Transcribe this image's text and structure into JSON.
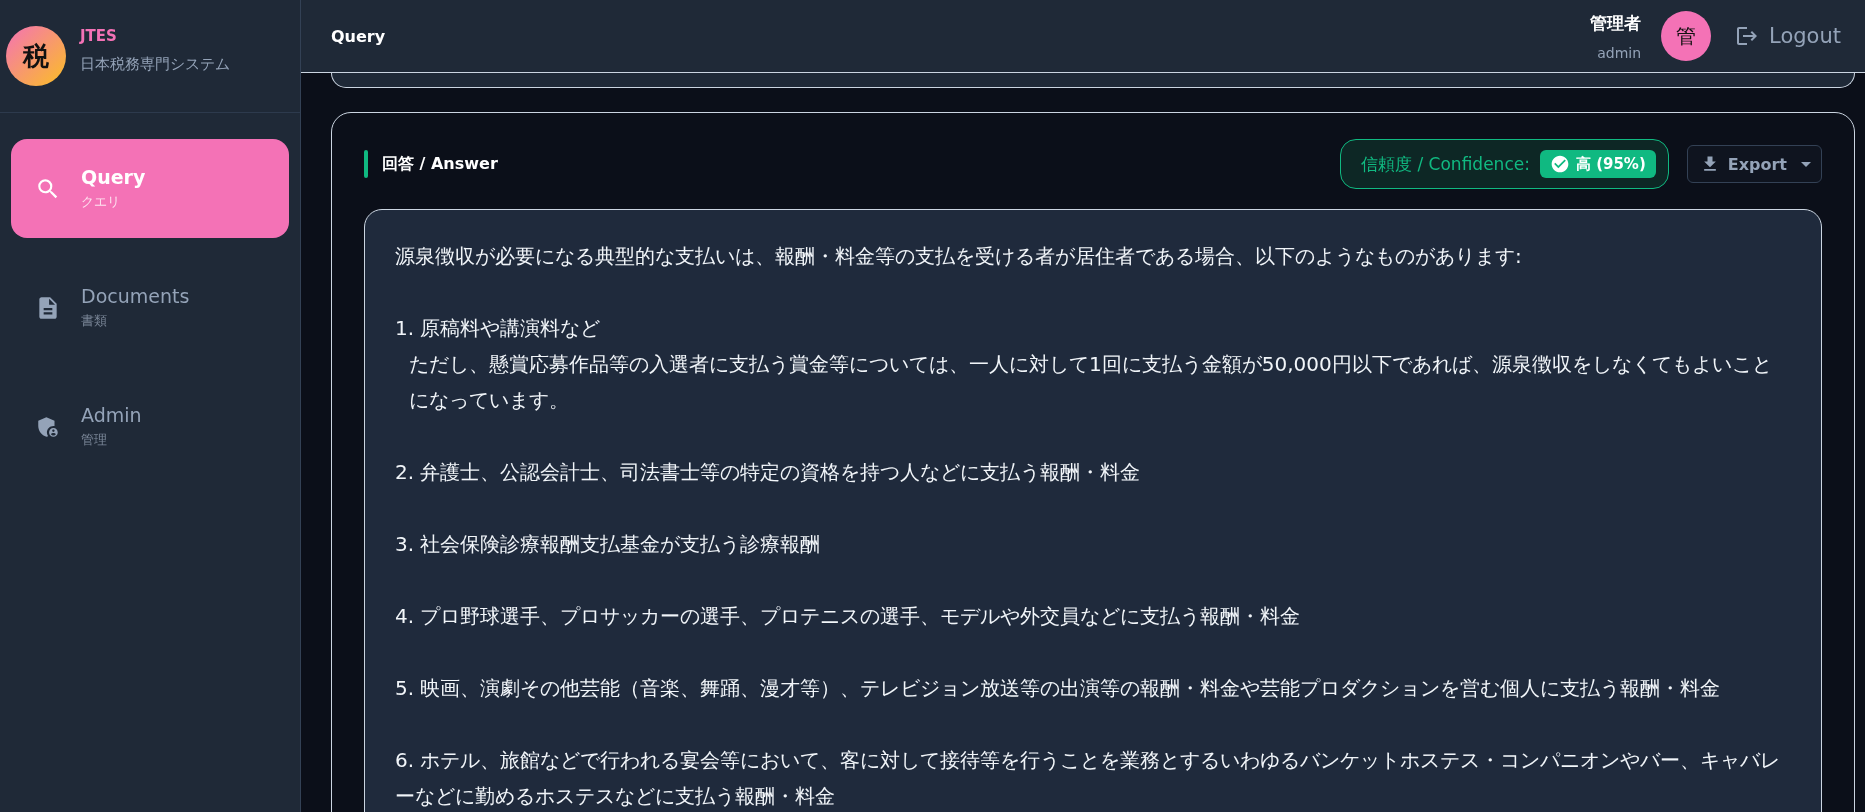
{
  "sidebar": {
    "logo": {
      "mark": "税",
      "title": "JTES",
      "subtitle": "日本税務専門システム"
    },
    "items": [
      {
        "kind": "query",
        "label": "Query",
        "sublabel": "クエリ",
        "selected": true
      },
      {
        "kind": "documents",
        "label": "Documents",
        "sublabel": "書類",
        "selected": false
      },
      {
        "kind": "admin",
        "label": "Admin",
        "sublabel": "管理",
        "selected": false
      }
    ]
  },
  "header": {
    "title": "Query",
    "user": {
      "name": "管理者",
      "role": "admin",
      "avatar": "管"
    },
    "logout": "Logout"
  },
  "answer": {
    "title": "回答 / Answer",
    "confidence": {
      "label": "信頼度 / Confidence:",
      "value": "高 (95%)"
    },
    "export": "Export",
    "intro": "源泉徴収が必要になる典型的な支払いは、報酬・料金等の支払を受ける者が居住者である場合、以下のようなものがあります:",
    "items": [
      {
        "title": "1. 原稿料や講演料など",
        "note": "ただし、懸賞応募作品等の入選者に支払う賞金等については、一人に対して1回に支払う金額が50,000円以下であれば、源泉徴収をしなくてもよいことになっています。"
      },
      {
        "title": "2. 弁護士、公認会計士、司法書士等の特定の資格を持つ人などに支払う報酬・料金"
      },
      {
        "title": "3. 社会保険診療報酬支払基金が支払う診療報酬"
      },
      {
        "title": "4. プロ野球選手、プロサッカーの選手、プロテニスの選手、モデルや外交員などに支払う報酬・料金"
      },
      {
        "title": "5. 映画、演劇その他芸能（音楽、舞踊、漫才等）、テレビジョン放送等の出演等の報酬・料金や芸能プロダクションを営む個人に支払う報酬・料金"
      },
      {
        "title": "6. ホテル、旅館などで行われる宴会等において、客に対して接待等を行うことを業務とするいわゆるバンケットホステス・コンパニオンやバー、キャバレーなどに勤めるホステスなどに支払う報酬・料金"
      }
    ]
  }
}
